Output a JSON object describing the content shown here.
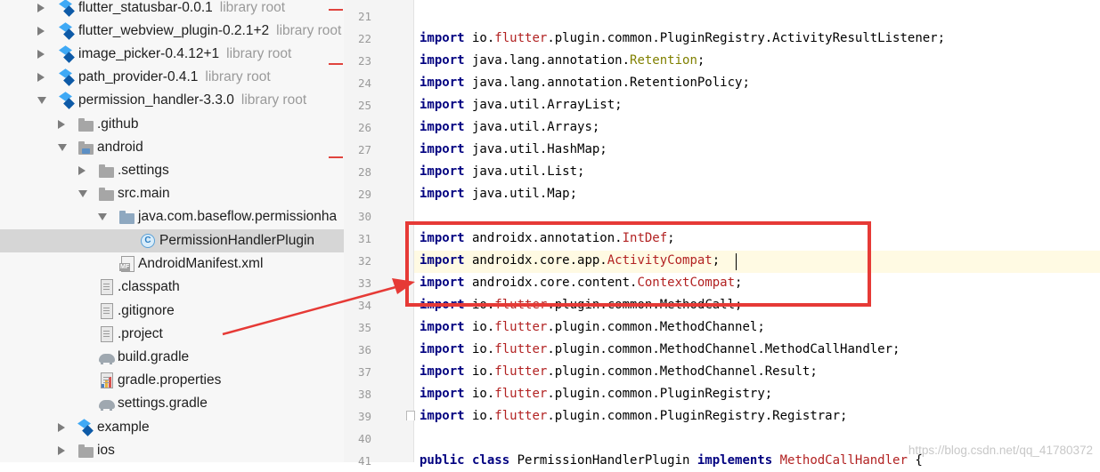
{
  "project_tree": {
    "items": [
      {
        "label": "flutter_statusbar-0.0.1",
        "hint": "library root",
        "icon": "flutter-icon",
        "expand": "right"
      },
      {
        "label": "flutter_webview_plugin-0.2.1+2",
        "hint": "library root",
        "icon": "flutter-icon",
        "expand": "right"
      },
      {
        "label": "image_picker-0.4.12+1",
        "hint": "library root",
        "icon": "flutter-icon",
        "expand": "right"
      },
      {
        "label": "path_provider-0.4.1",
        "hint": "library root",
        "icon": "flutter-icon",
        "expand": "right"
      },
      {
        "label": "permission_handler-3.3.0",
        "hint": "library root",
        "icon": "flutter-icon",
        "expand": "down"
      },
      {
        "label": ".github",
        "icon": "folder-icon",
        "expand": "right"
      },
      {
        "label": "android",
        "icon": "module-folder-icon",
        "expand": "down"
      },
      {
        "label": ".settings",
        "icon": "folder-icon",
        "expand": "right"
      },
      {
        "label": "src.main",
        "icon": "folder-icon",
        "expand": "down"
      },
      {
        "label": "java.com.baseflow.permissionha",
        "icon": "source-folder-icon",
        "expand": "down"
      },
      {
        "label": "PermissionHandlerPlugin",
        "icon": "class-icon",
        "selected": true
      },
      {
        "label": "AndroidManifest.xml",
        "icon": "manifest-icon"
      },
      {
        "label": ".classpath",
        "icon": "file-icon"
      },
      {
        "label": ".gitignore",
        "icon": "file-icon"
      },
      {
        "label": ".project",
        "icon": "file-icon"
      },
      {
        "label": "build.gradle",
        "icon": "gradle-icon"
      },
      {
        "label": "gradle.properties",
        "icon": "properties-icon"
      },
      {
        "label": "settings.gradle",
        "icon": "gradle-icon"
      },
      {
        "label": "example",
        "icon": "flutter-icon",
        "expand": "right"
      },
      {
        "label": "ios",
        "icon": "folder-icon",
        "expand": "right"
      }
    ],
    "class_icon_letter": "C",
    "manifest_icon_letters": "MF"
  },
  "editor": {
    "lines": [
      {
        "n": "21",
        "tokens": []
      },
      {
        "n": "22",
        "tokens": [
          [
            "kw",
            "import"
          ],
          [
            "t",
            " io."
          ],
          [
            "pk",
            "flutter"
          ],
          [
            "t",
            ".plugin.common.PluginRegistry.ActivityResultListener;"
          ]
        ]
      },
      {
        "n": "23",
        "tokens": [
          [
            "kw",
            "import"
          ],
          [
            "t",
            " java.lang.annotation."
          ],
          [
            "an",
            "Retention"
          ],
          [
            "t",
            ";"
          ]
        ]
      },
      {
        "n": "24",
        "tokens": [
          [
            "kw",
            "import"
          ],
          [
            "t",
            " java.lang.annotation.RetentionPolicy;"
          ]
        ]
      },
      {
        "n": "25",
        "tokens": [
          [
            "kw",
            "import"
          ],
          [
            "t",
            " java.util.ArrayList;"
          ]
        ]
      },
      {
        "n": "26",
        "tokens": [
          [
            "kw",
            "import"
          ],
          [
            "t",
            " java.util.Arrays;"
          ]
        ]
      },
      {
        "n": "27",
        "tokens": [
          [
            "kw",
            "import"
          ],
          [
            "t",
            " java.util.HashMap;"
          ]
        ]
      },
      {
        "n": "28",
        "tokens": [
          [
            "kw",
            "import"
          ],
          [
            "t",
            " java.util.List;"
          ]
        ]
      },
      {
        "n": "29",
        "tokens": [
          [
            "kw",
            "import"
          ],
          [
            "t",
            " java.util.Map;"
          ]
        ]
      },
      {
        "n": "30",
        "tokens": []
      },
      {
        "n": "31",
        "tokens": [
          [
            "kw",
            "import"
          ],
          [
            "t",
            " androidx.annotation."
          ],
          [
            "pk",
            "IntDef"
          ],
          [
            "t",
            ";"
          ]
        ]
      },
      {
        "n": "32",
        "tokens": [
          [
            "kw",
            "import"
          ],
          [
            "t",
            " androidx.core.app."
          ],
          [
            "pk",
            "ActivityCompat"
          ],
          [
            "t",
            ";"
          ]
        ]
      },
      {
        "n": "33",
        "tokens": [
          [
            "kw",
            "import"
          ],
          [
            "t",
            " androidx.core.content."
          ],
          [
            "pk",
            "ContextCompat"
          ],
          [
            "t",
            ";"
          ]
        ]
      },
      {
        "n": "34",
        "tokens": [
          [
            "kw",
            "import"
          ],
          [
            "t",
            " io."
          ],
          [
            "pk",
            "flutter"
          ],
          [
            "t",
            ".plugin.common.MethodCall;"
          ]
        ]
      },
      {
        "n": "35",
        "tokens": [
          [
            "kw",
            "import"
          ],
          [
            "t",
            " io."
          ],
          [
            "pk",
            "flutter"
          ],
          [
            "t",
            ".plugin.common.MethodChannel;"
          ]
        ]
      },
      {
        "n": "36",
        "tokens": [
          [
            "kw",
            "import"
          ],
          [
            "t",
            " io."
          ],
          [
            "pk",
            "flutter"
          ],
          [
            "t",
            ".plugin.common.MethodChannel.MethodCallHandler;"
          ]
        ]
      },
      {
        "n": "37",
        "tokens": [
          [
            "kw",
            "import"
          ],
          [
            "t",
            " io."
          ],
          [
            "pk",
            "flutter"
          ],
          [
            "t",
            ".plugin.common.MethodChannel.Result;"
          ]
        ]
      },
      {
        "n": "38",
        "tokens": [
          [
            "kw",
            "import"
          ],
          [
            "t",
            " io."
          ],
          [
            "pk",
            "flutter"
          ],
          [
            "t",
            ".plugin.common.PluginRegistry;"
          ]
        ]
      },
      {
        "n": "39",
        "tokens": [
          [
            "kw",
            "import"
          ],
          [
            "t",
            " io."
          ],
          [
            "pk",
            "flutter"
          ],
          [
            "t",
            ".plugin.common.PluginRegistry.Registrar;"
          ]
        ]
      },
      {
        "n": "40",
        "tokens": []
      },
      {
        "n": "41",
        "tokens": [
          [
            "kw",
            "public class"
          ],
          [
            "t",
            " PermissionHandlerPlugin "
          ],
          [
            "kw",
            "implements"
          ],
          [
            "t",
            " "
          ],
          [
            "pk",
            "MethodCallHandler"
          ],
          [
            "t",
            " {"
          ]
        ]
      }
    ]
  },
  "watermark": "https://blog.csdn.net/qq_41780372",
  "colors": {
    "highlight_box": "#e63a36",
    "keyword": "#000080",
    "package_red": "#b22222",
    "annotation": "#808000"
  }
}
